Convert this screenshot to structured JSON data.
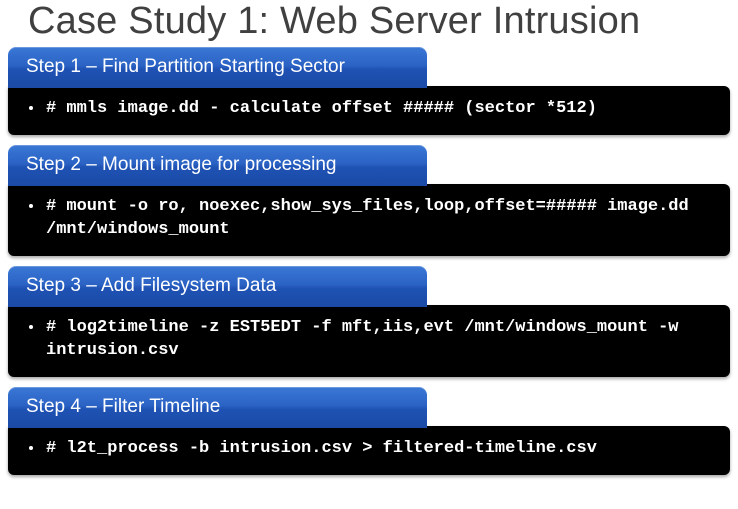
{
  "title": "Case Study 1: Web Server Intrusion",
  "steps": [
    {
      "header": "Step 1 – Find Partition Starting Sector",
      "command": "# mmls image.dd - calculate offset ##### (sector *512)"
    },
    {
      "header": "Step 2 – Mount image for processing",
      "command": "# mount -o ro, noexec,show_sys_files,loop,offset=##### image.dd /mnt/windows_mount"
    },
    {
      "header": "Step 3 – Add Filesystem Data",
      "command": "# log2timeline -z EST5EDT -f mft,iis,evt /mnt/windows_mount -w intrusion.csv"
    },
    {
      "header": "Step 4 – Filter Timeline",
      "command": "# l2t_process -b intrusion.csv > filtered-timeline.csv"
    }
  ]
}
